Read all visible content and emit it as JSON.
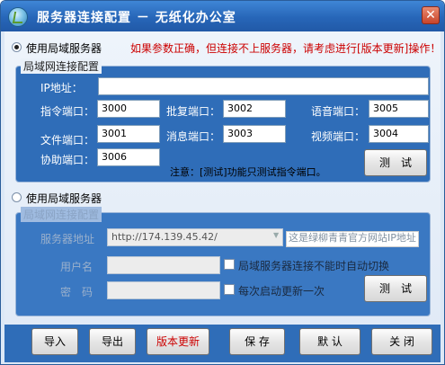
{
  "window": {
    "title": "服务器连接配置 － 无纸化办公室",
    "close_label": "✕"
  },
  "mode_lan": {
    "label": "使用局域服务器",
    "checked": true
  },
  "warning": "如果参数正确，但连接不上服务器，请考虑进行[版本更新]操作！",
  "lan_group": {
    "title": "局域网连接配置",
    "ip_label": "IP地址：",
    "ip_value": "",
    "fields": [
      {
        "label": "指令端口：",
        "value": "3000"
      },
      {
        "label": "批复端口：",
        "value": "3002"
      },
      {
        "label": "语音端口：",
        "value": "3005"
      },
      {
        "label": "文件端口：",
        "value": "3001"
      },
      {
        "label": "消息端口：",
        "value": "3003"
      },
      {
        "label": "视频端口：",
        "value": "3004"
      },
      {
        "label": "协助端口：",
        "value": "3006"
      }
    ],
    "note": "注意：[测试]功能只测试指令端口。",
    "test_button": "测　试"
  },
  "mode_wan": {
    "label": "使用局域服务器",
    "checked": false
  },
  "wan_group": {
    "title": "局域网连接配置",
    "server_label": "服务器地址",
    "server_value": "http://174.139.45.42/",
    "server_hint": "这是绿柳青青官方网站IP地址",
    "user_label": "用户名",
    "password_label": "密　码",
    "auto_switch_label": "局域服务器连接不能时自动切换",
    "auto_update_label": "每次启动更新一次",
    "test_button": "测　试"
  },
  "footer": {
    "import": "导入",
    "export": "导出",
    "update": "版本更新",
    "save": "保 存",
    "default": "默 认",
    "close": "关 闭"
  },
  "colors": {
    "warning": "#cc0000",
    "update_text": "#cc0000",
    "title_bar": "#2766b8",
    "group_bg": "#2f6db8"
  }
}
